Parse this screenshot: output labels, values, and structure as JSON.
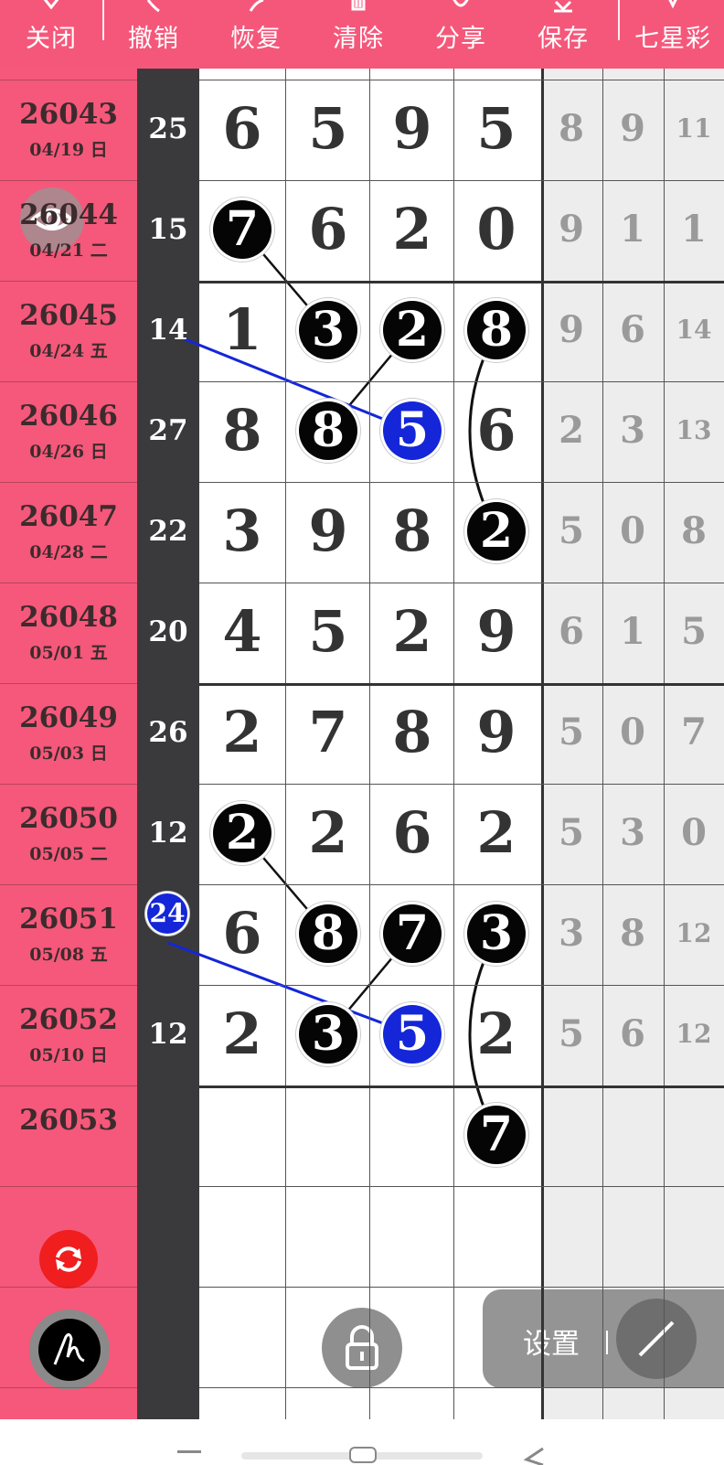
{
  "toolbar": {
    "items": [
      {
        "label": "关闭",
        "icon": "close-icon"
      },
      {
        "label": "撤销",
        "icon": "undo-icon"
      },
      {
        "label": "恢复",
        "icon": "redo-icon"
      },
      {
        "label": "清除",
        "icon": "trash-icon"
      },
      {
        "label": "分享",
        "icon": "share-icon"
      },
      {
        "label": "保存",
        "icon": "download-icon"
      },
      {
        "label": "七星彩",
        "icon": "pin-icon"
      }
    ]
  },
  "rows": [
    {
      "period": "26043",
      "date": "04/19 日",
      "sum": "25",
      "digits": [
        "6",
        "5",
        "9",
        "5"
      ],
      "stats": [
        "8",
        "9",
        "11"
      ]
    },
    {
      "period": "26044",
      "date": "04/21 二",
      "sum": "15",
      "digits": [
        "7",
        "6",
        "2",
        "0"
      ],
      "stats": [
        "9",
        "1",
        "1"
      ]
    },
    {
      "period": "26045",
      "date": "04/24 五",
      "sum": "14",
      "digits": [
        "1",
        "3",
        "2",
        "8"
      ],
      "stats": [
        "9",
        "6",
        "14"
      ]
    },
    {
      "period": "26046",
      "date": "04/26 日",
      "sum": "27",
      "digits": [
        "8",
        "8",
        "5",
        "6"
      ],
      "stats": [
        "2",
        "3",
        "13"
      ]
    },
    {
      "period": "26047",
      "date": "04/28 二",
      "sum": "22",
      "digits": [
        "3",
        "9",
        "8",
        "2"
      ],
      "stats": [
        "5",
        "0",
        "8"
      ]
    },
    {
      "period": "26048",
      "date": "05/01 五",
      "sum": "20",
      "digits": [
        "4",
        "5",
        "2",
        "9"
      ],
      "stats": [
        "6",
        "1",
        "5"
      ]
    },
    {
      "period": "26049",
      "date": "05/03 日",
      "sum": "26",
      "digits": [
        "2",
        "7",
        "8",
        "9"
      ],
      "stats": [
        "5",
        "0",
        "7"
      ]
    },
    {
      "period": "26050",
      "date": "05/05 二",
      "sum": "12",
      "digits": [
        "2",
        "2",
        "6",
        "2"
      ],
      "stats": [
        "5",
        "3",
        "0"
      ]
    },
    {
      "period": "26051",
      "date": "05/08 五",
      "sum": "24",
      "digits": [
        "6",
        "8",
        "7",
        "3"
      ],
      "stats": [
        "3",
        "8",
        "12"
      ]
    },
    {
      "period": "26052",
      "date": "05/10 日",
      "sum": "12",
      "digits": [
        "2",
        "3",
        "5",
        "2"
      ],
      "stats": [
        "5",
        "6",
        "12"
      ]
    },
    {
      "period": "26053",
      "date": "",
      "sum": "",
      "digits": [
        "",
        "",
        "",
        "7"
      ],
      "stats": [
        "",
        "",
        ""
      ]
    }
  ],
  "circled": [
    {
      "row": 1,
      "col": 0,
      "color": "black"
    },
    {
      "row": 2,
      "col": 1,
      "color": "black"
    },
    {
      "row": 2,
      "col": 2,
      "color": "black"
    },
    {
      "row": 2,
      "col": 3,
      "color": "black"
    },
    {
      "row": 3,
      "col": 1,
      "color": "black"
    },
    {
      "row": 3,
      "col": 2,
      "color": "blue"
    },
    {
      "row": 4,
      "col": 3,
      "color": "black"
    },
    {
      "row": 7,
      "col": 0,
      "color": "black"
    },
    {
      "row": 8,
      "col": 1,
      "color": "black"
    },
    {
      "row": 8,
      "col": 2,
      "color": "black"
    },
    {
      "row": 8,
      "col": 3,
      "color": "black"
    },
    {
      "row": 9,
      "col": 1,
      "color": "black"
    },
    {
      "row": 9,
      "col": 2,
      "color": "blue"
    },
    {
      "row": 10,
      "col": 3,
      "color": "black"
    }
  ],
  "highlighted_sums": [
    8
  ],
  "controls": {
    "settings_label": "设置",
    "eye_icon": "eye-icon",
    "refresh_icon": "refresh-icon",
    "pen_icon": "pen-icon",
    "lock_icon": "lock-icon",
    "line_tool_icon": "line-tool-icon"
  },
  "colors": {
    "brand_pink": "#f5577a",
    "dark_column": "#3a3a3c",
    "ball_black": "#050505",
    "ball_blue": "#1426d8",
    "refresh_red": "#f01e1e"
  }
}
